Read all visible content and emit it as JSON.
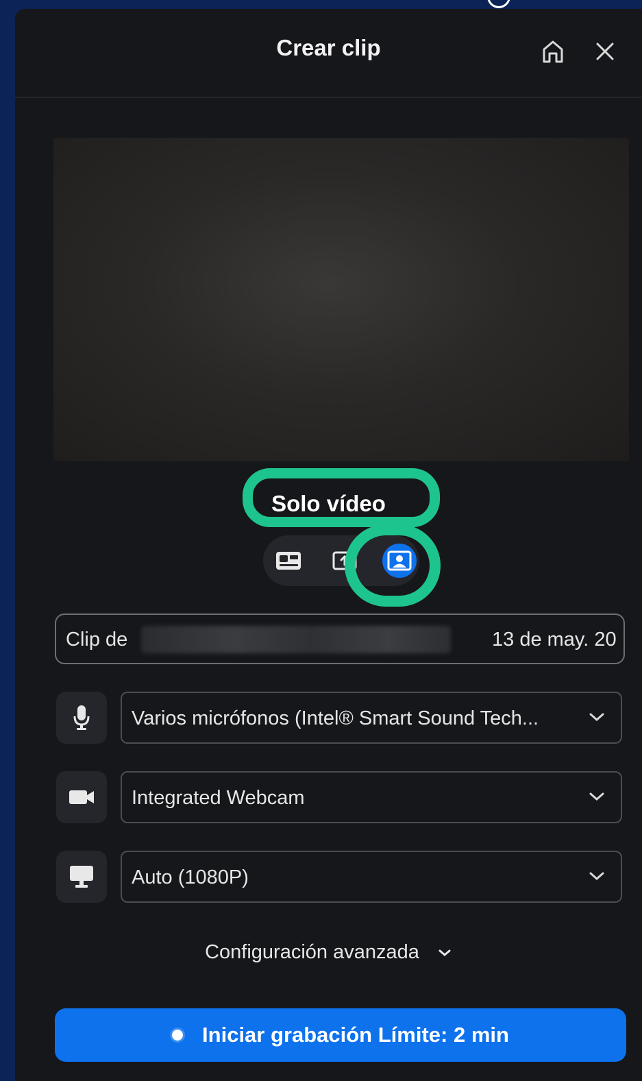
{
  "window": {
    "title": "Crear clip"
  },
  "header": {
    "home_icon": "home-icon",
    "close_icon": "close-icon"
  },
  "recording_mode": {
    "label": "Solo vídeo",
    "options": [
      {
        "icon": "screen-and-camera-icon",
        "active": false
      },
      {
        "icon": "share-screen-icon",
        "active": false
      },
      {
        "icon": "camera-only-icon",
        "active": true
      }
    ]
  },
  "clip_name": {
    "prefix": "Clip de",
    "suffix": "13 de may. 20"
  },
  "microphone": {
    "icon": "microphone-icon",
    "value": "Varios micrófonos (Intel® Smart Sound Tech..."
  },
  "camera": {
    "icon": "camera-icon",
    "value": "Integrated Webcam"
  },
  "resolution": {
    "icon": "monitor-icon",
    "value": "Auto (1080P)"
  },
  "advanced": {
    "label": "Configuración avanzada"
  },
  "start": {
    "label": "Iniciar grabación Límite: 2 min"
  },
  "colors": {
    "accent": "#0e72ed",
    "highlight": "#1ec48d",
    "panel": "#16171a",
    "backdrop": "#0b2357"
  }
}
